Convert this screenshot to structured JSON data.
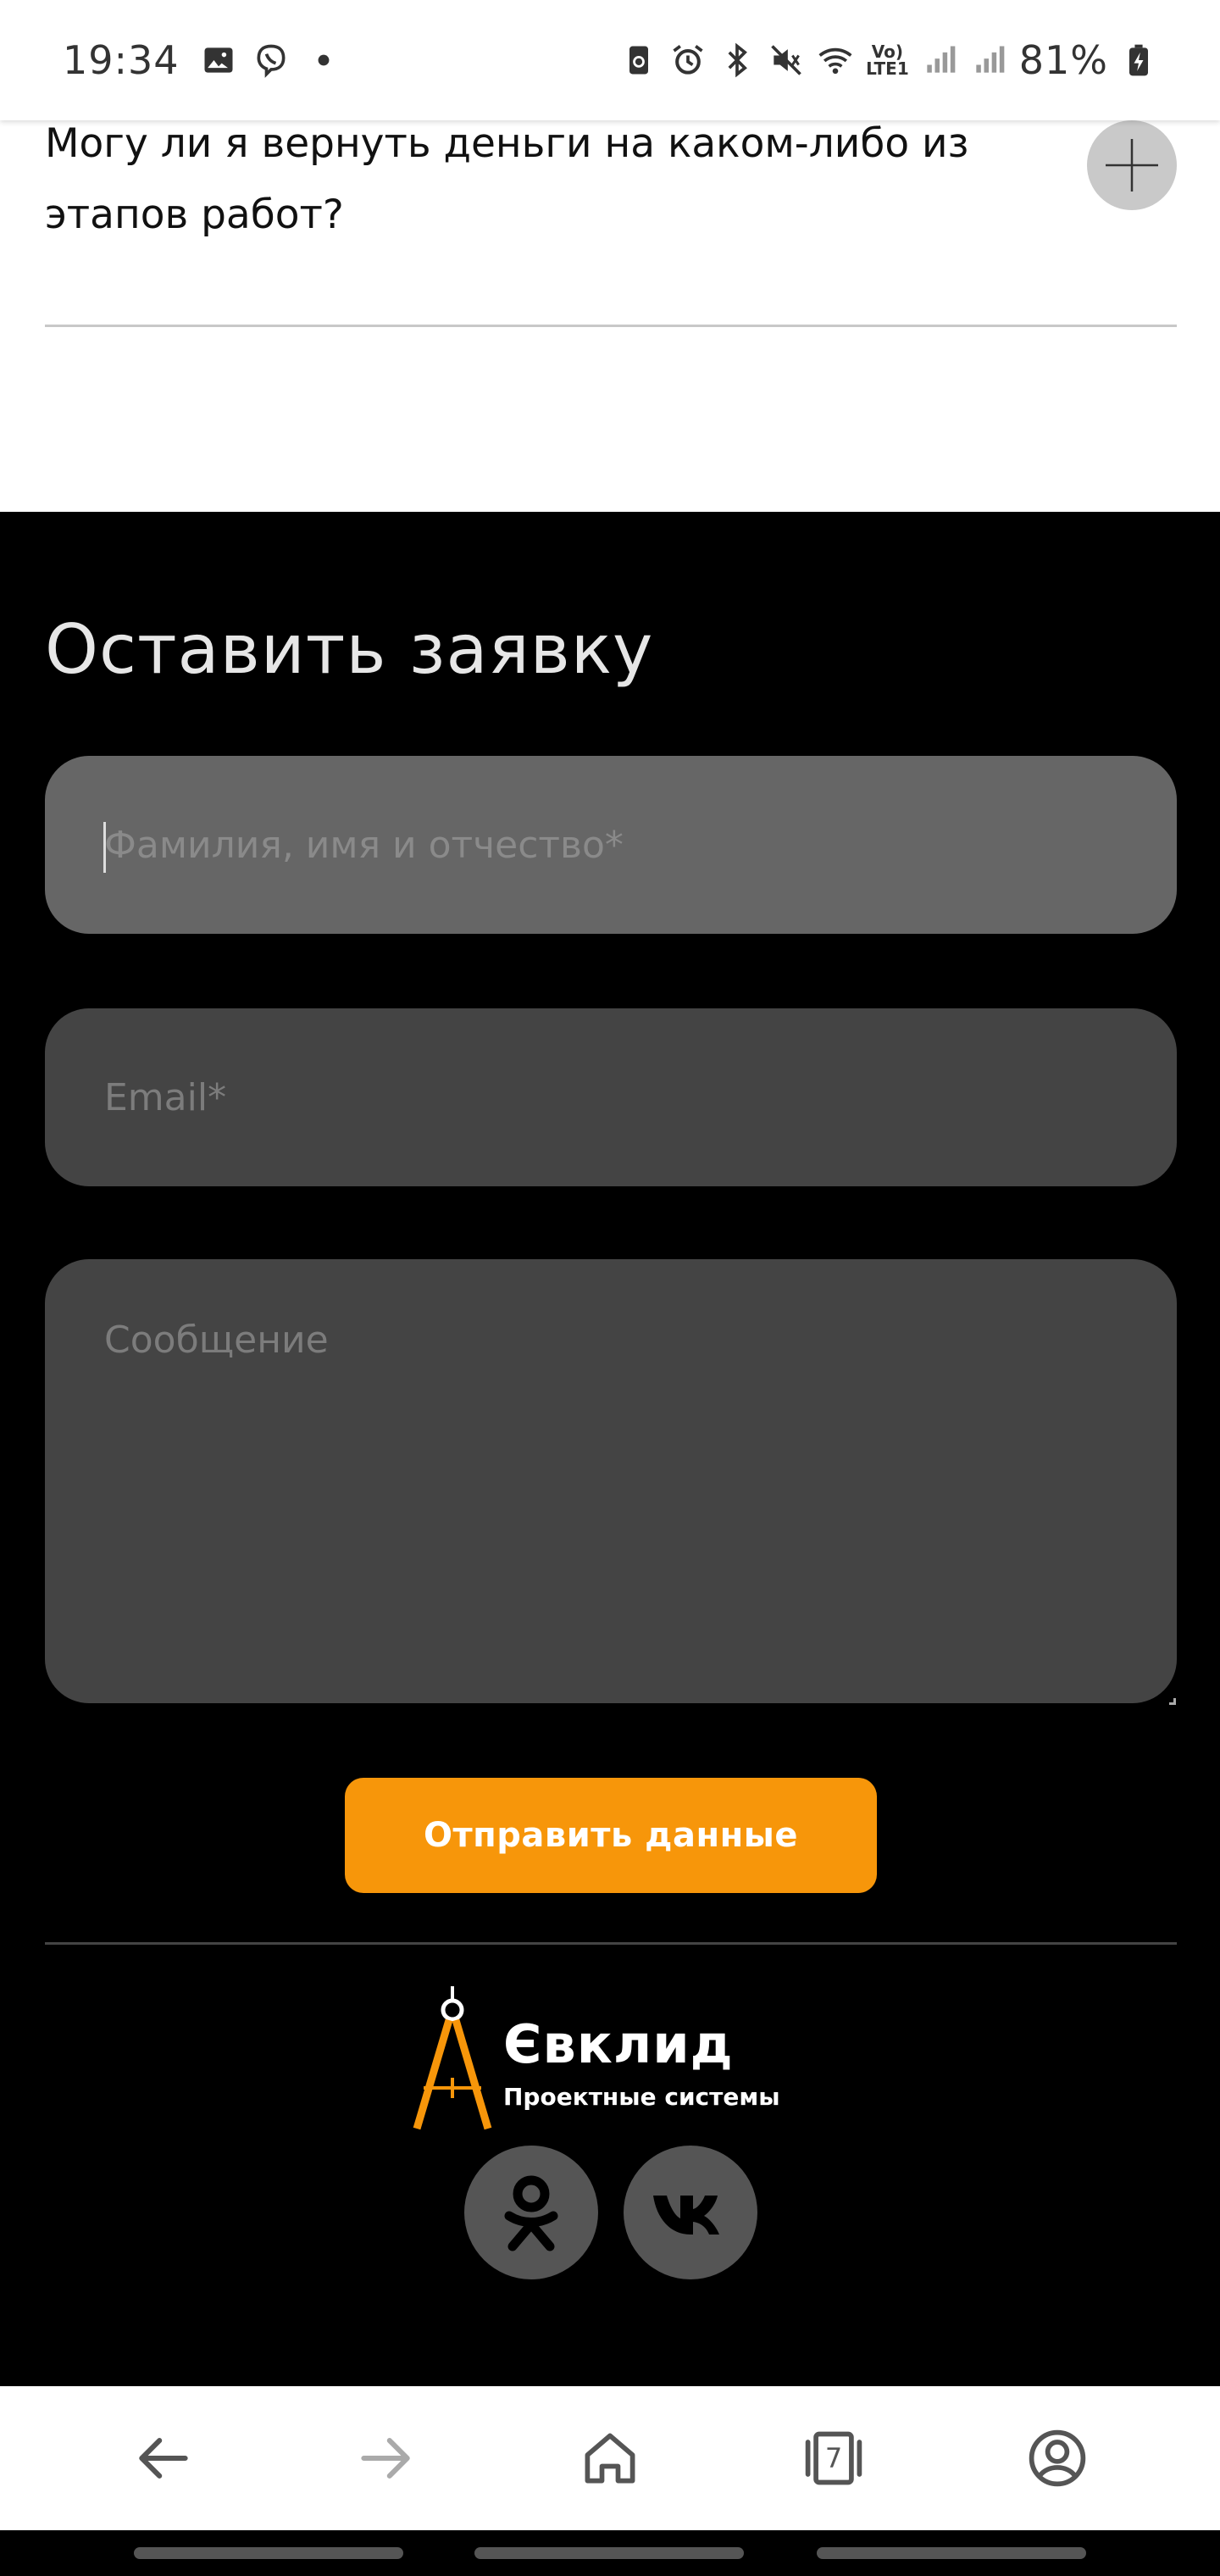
{
  "status_bar": {
    "time": "19:34",
    "battery": "81%",
    "volte": [
      "Vo)",
      "LTE1"
    ],
    "icons": [
      "gallery-icon",
      "viber-icon",
      "dot-icon",
      "recycle-icon",
      "alarm-icon",
      "bluetooth-icon",
      "mute-icon",
      "wifi-icon",
      "volte-icon",
      "signal-icon",
      "signal-icon",
      "battery-charging-icon"
    ]
  },
  "faq": {
    "question": "Могу ли я вернуть деньги на каком-либо из этапов работ?",
    "toggle_icon": "plus-icon"
  },
  "form": {
    "title": "Оставить заявку",
    "name_placeholder": "Фамилия, имя и отчество*",
    "email_placeholder": "Email*",
    "message_placeholder": "Сообщение",
    "submit_label": "Отправить данные"
  },
  "footer": {
    "logo_name": "Євклид",
    "logo_tagline": "Проектные системы",
    "social": [
      "odnoklassniki-icon",
      "vk-icon"
    ]
  },
  "browser_bar": {
    "tabs_count": "7",
    "buttons": [
      "back-arrow-icon",
      "forward-arrow-icon",
      "home-icon",
      "tabs-icon",
      "profile-icon"
    ]
  },
  "colors": {
    "accent": "#f7960a",
    "background_dark": "#000000",
    "field_active": "#666666",
    "field": "#444444"
  }
}
